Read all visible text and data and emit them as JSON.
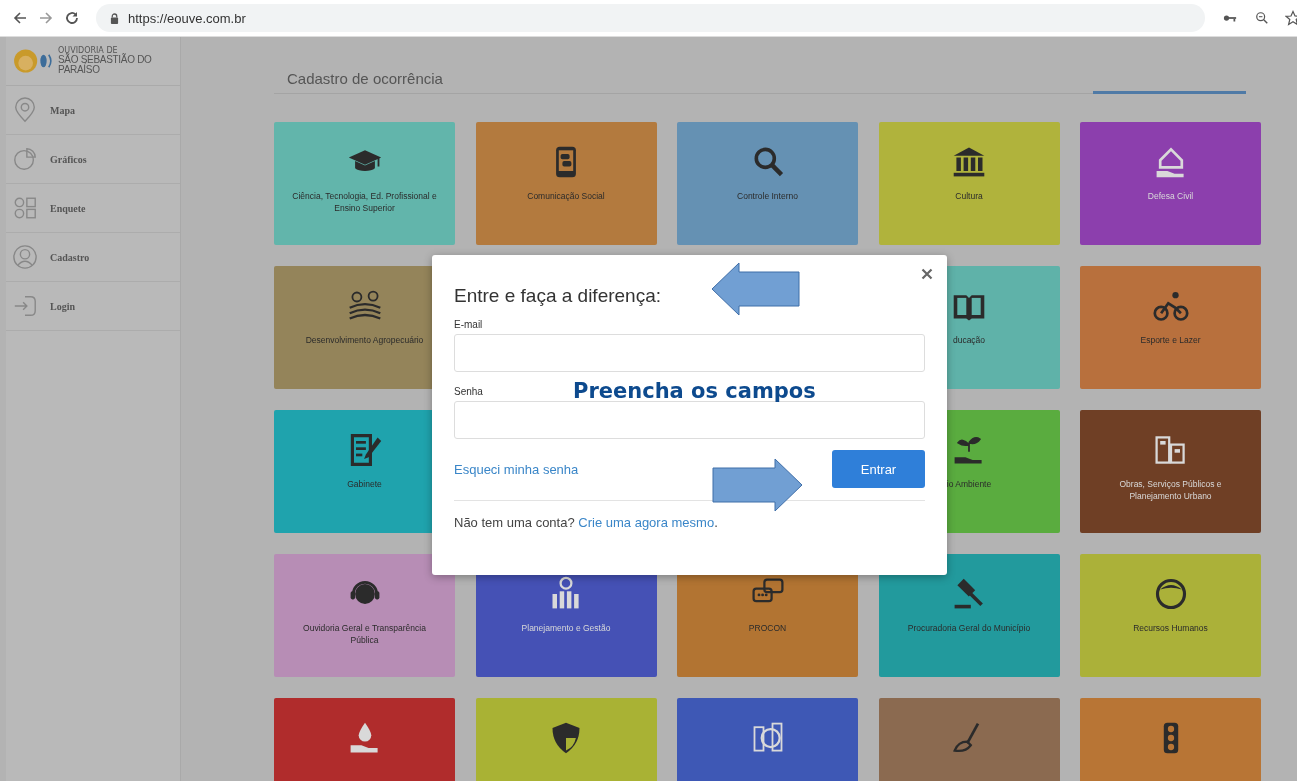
{
  "browser": {
    "url": "https://eouve.com.br"
  },
  "sidebar": {
    "brand": {
      "line_1": "OUVIDORIA DE",
      "line_2": "SÃO SEBASTIÃO DO",
      "line_3": "PARAÍSO"
    },
    "items": [
      {
        "label": "Mapa"
      },
      {
        "label": "Gráficos"
      },
      {
        "label": "Enquete"
      },
      {
        "label": "Cadastro"
      },
      {
        "label": "Login"
      }
    ]
  },
  "page": {
    "title": "Cadastro de ocorrência"
  },
  "tiles": [
    {
      "kind": "tile",
      "label": "Ciência, Tecnologia, Ed. Profissional e Ensino Superior",
      "color": "#62b5ab"
    },
    {
      "kind": "tile",
      "label": "Comunicação Social",
      "color": "#b37a3e"
    },
    {
      "kind": "tile",
      "label": "Controle Interno",
      "color": "#6591b3"
    },
    {
      "kind": "tile",
      "label": "Cultura",
      "color": "#b0b33c"
    },
    {
      "kind": "tile",
      "label": "Defesa Civil",
      "color": "#8c3fad"
    },
    {
      "kind": "tile",
      "label": "Desenvolvimento Agropecuário",
      "color": "#94845a"
    },
    {
      "kind": "hidden"
    },
    {
      "kind": "hidden"
    },
    {
      "kind": "tile",
      "label": "ducação",
      "color": "#5fb2a9"
    },
    {
      "kind": "tile",
      "label": "Esporte e Lazer",
      "color": "#b8703d"
    },
    {
      "kind": "tile",
      "label": "Gabinete",
      "color": "#1fa3ad"
    },
    {
      "kind": "hidden"
    },
    {
      "kind": "hidden"
    },
    {
      "kind": "tile",
      "label": "io Ambiente",
      "color": "#5aac3f"
    },
    {
      "kind": "tile",
      "label": "Obras, Serviços Públicos e Planejamento Urbano",
      "color": "#6f3f25"
    },
    {
      "kind": "tile",
      "label": "Ouvidoria Geral e Transparência Pública",
      "color": "#b78db5"
    },
    {
      "kind": "tile",
      "label": "Planejamento e Gestão",
      "color": "#4551b5"
    },
    {
      "kind": "tile",
      "label": "PROCON",
      "color": "#b27432"
    },
    {
      "kind": "tile",
      "label": "Procuradoria Geral do Município",
      "color": "#229a9d"
    },
    {
      "kind": "tile",
      "label": "Recursos Humanos",
      "color": "#abb139"
    },
    {
      "kind": "tile",
      "color": "#b02c2c"
    },
    {
      "kind": "tile",
      "color": "#a9b234"
    },
    {
      "kind": "tile",
      "color": "#3e58b5"
    },
    {
      "kind": "tile",
      "color": "#8b6a50"
    },
    {
      "kind": "tile",
      "color": "#b87535"
    }
  ],
  "dialog": {
    "title": "Entre e faça a diferença:",
    "email_label": "E-mail",
    "password_label": "Senha",
    "forgot_link": "Esqueci minha senha",
    "submit": "Entrar",
    "footer_text": "Não tem uma conta?",
    "signup_link": "Crie uma agora mesmo",
    "footer_end": "."
  },
  "annotation": {
    "text": "Preencha os campos"
  }
}
